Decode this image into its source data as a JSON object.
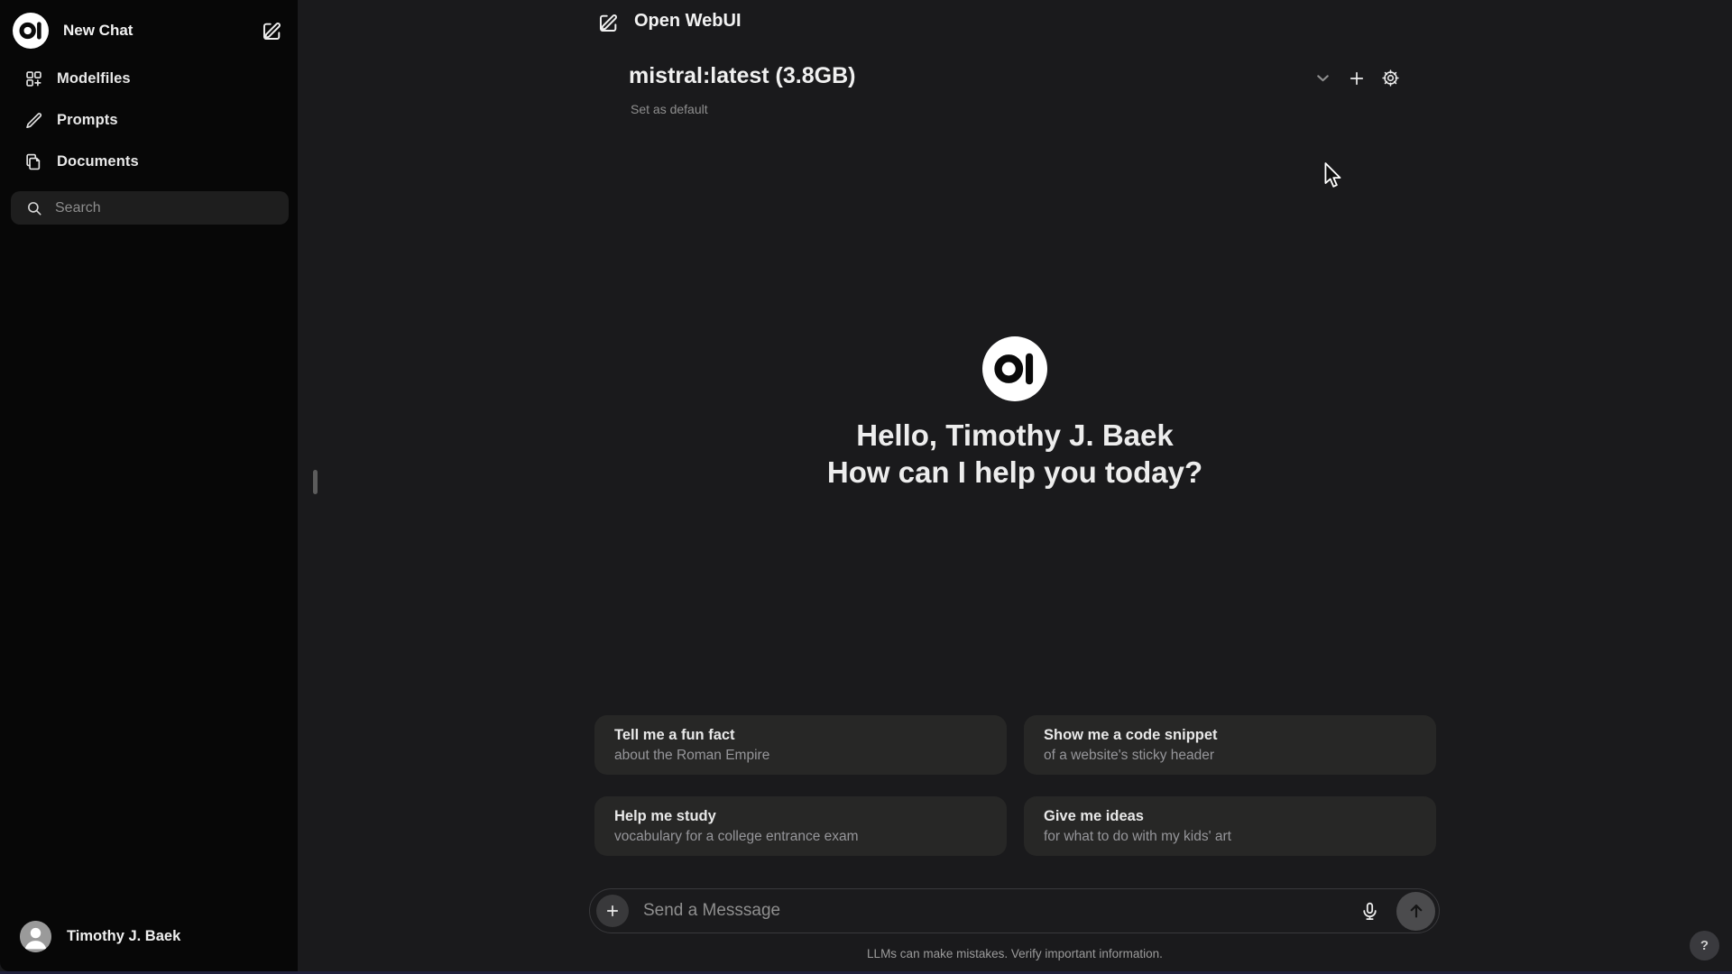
{
  "sidebar": {
    "new_chat_label": "New Chat",
    "items": [
      {
        "label": "Modelfiles"
      },
      {
        "label": "Prompts"
      },
      {
        "label": "Documents"
      }
    ],
    "search_placeholder": "Search",
    "user_name": "Timothy J. Baek"
  },
  "header": {
    "app_title": "Open WebUI",
    "model_name": "mistral:latest (3.8GB)",
    "set_default_label": "Set as default"
  },
  "hero": {
    "greeting_line1": "Hello, Timothy J. Baek",
    "greeting_line2": "How can I help you today?"
  },
  "suggestions": [
    {
      "title": "Tell me a fun fact",
      "subtitle": "about the Roman Empire"
    },
    {
      "title": "Show me a code snippet",
      "subtitle": "of a website's sticky header"
    },
    {
      "title": "Help me study",
      "subtitle": "vocabulary for a college entrance exam"
    },
    {
      "title": "Give me ideas",
      "subtitle": "for what to do with my kids' art"
    }
  ],
  "composer": {
    "placeholder": "Send a Messsage",
    "disclaimer": "LLMs can make mistakes. Verify important information."
  },
  "help": {
    "label": "?"
  },
  "colors": {
    "sidebar_bg": "#070707",
    "main_bg": "#1a1a1c",
    "card_bg": "#272726",
    "accent_text": "#ececec",
    "muted_text": "#8f8f8f"
  }
}
